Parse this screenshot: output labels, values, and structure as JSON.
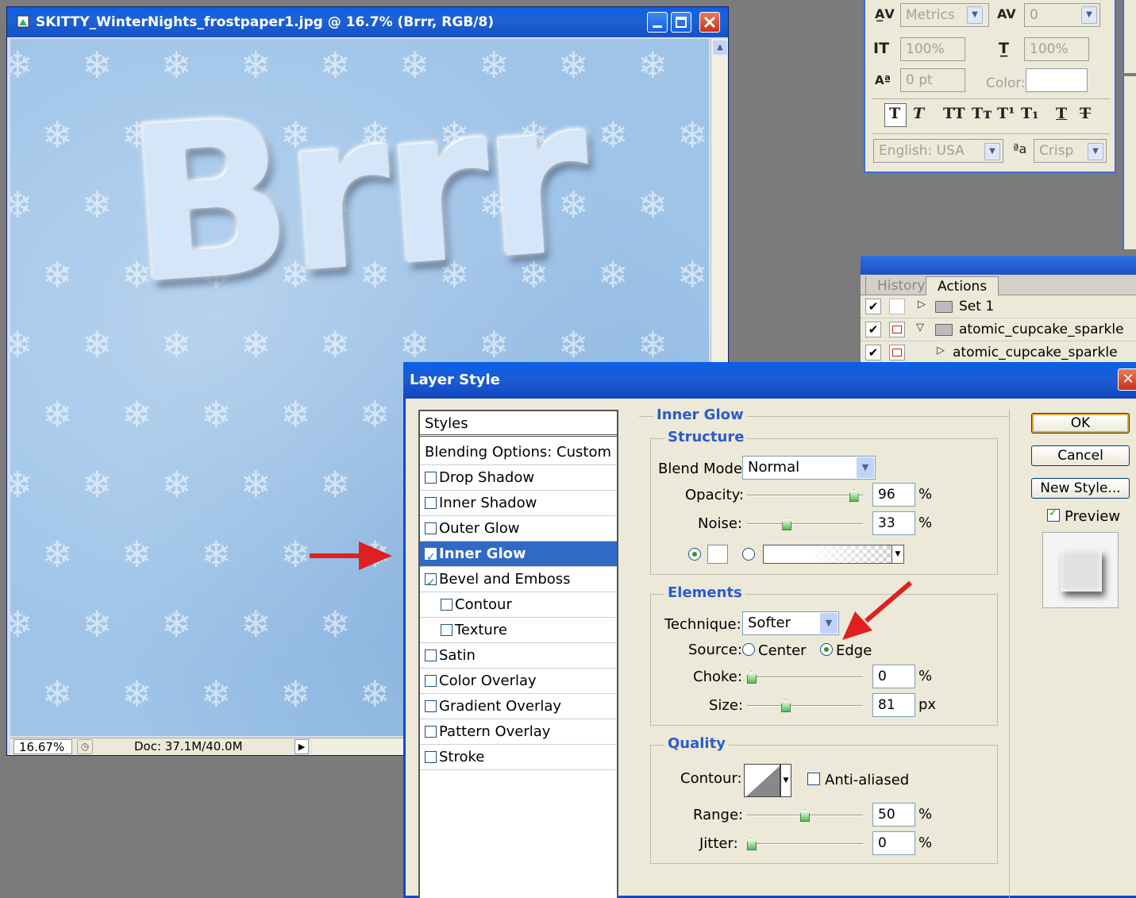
{
  "document": {
    "title": "SKITTY_WinterNights_frostpaper1.jpg @ 16.7% (Brrr, RGB/8)",
    "canvas_text": "Brrr",
    "zoom": "16.67%",
    "doc_size": "Doc: 37.1M/40.0M"
  },
  "character": {
    "font_kerning": "Metrics",
    "tracking": "0",
    "vertical_scale": "100%",
    "horizontal_scale": "100%",
    "baseline_shift": "0 pt",
    "color_label": "Color:",
    "language": "English: USA",
    "antialias": "Crisp"
  },
  "actions_panel": {
    "tabs": [
      "History",
      "Actions"
    ],
    "rows": [
      {
        "label": "Set 1"
      },
      {
        "label": "atomic_cupcake_sparkle"
      },
      {
        "label": "atomic_cupcake_sparkle"
      }
    ]
  },
  "dialog": {
    "title": "Layer Style",
    "styles_header": "Styles",
    "blending": "Blending Options: Custom",
    "styles": [
      {
        "label": "Drop Shadow"
      },
      {
        "label": "Inner Shadow"
      },
      {
        "label": "Outer Glow"
      },
      {
        "label": "Inner Glow"
      },
      {
        "label": "Bevel and Emboss"
      },
      {
        "label": "Contour"
      },
      {
        "label": "Texture"
      },
      {
        "label": "Satin"
      },
      {
        "label": "Color Overlay"
      },
      {
        "label": "Gradient Overlay"
      },
      {
        "label": "Pattern Overlay"
      },
      {
        "label": "Stroke"
      }
    ],
    "checked": [
      false,
      false,
      false,
      true,
      true,
      false,
      false,
      false,
      false,
      false,
      false,
      false
    ],
    "section_title": "Inner Glow",
    "structure": {
      "title": "Structure",
      "blend_mode_label": "Blend Mode:",
      "blend_mode": "Normal",
      "opacity_label": "Opacity:",
      "opacity": "96",
      "opacity_level": 96,
      "noise_label": "Noise:",
      "noise": "33",
      "noise_level": 33,
      "percent": "%"
    },
    "elements": {
      "title": "Elements",
      "technique_label": "Technique:",
      "technique": "Softer",
      "source_label": "Source:",
      "source_center": "Center",
      "source_edge": "Edge",
      "choke_label": "Choke:",
      "choke": "0",
      "choke_level": 0,
      "size_label": "Size:",
      "size": "81",
      "size_level": 32,
      "px": "px",
      "percent": "%"
    },
    "quality": {
      "title": "Quality",
      "contour_label": "Contour:",
      "antialiased": "Anti-aliased",
      "range_label": "Range:",
      "range": "50",
      "range_level": 50,
      "jitter_label": "Jitter:",
      "jitter": "0",
      "jitter_level": 0,
      "percent": "%"
    },
    "buttons": {
      "ok": "OK",
      "cancel": "Cancel",
      "new_style": "New Style...",
      "preview": "Preview"
    }
  },
  "colors": {
    "title_bar": "#1f61d4",
    "selection": "#316ac5",
    "group_title": "#2a5bd0",
    "annotation_arrow": "#e02020"
  }
}
